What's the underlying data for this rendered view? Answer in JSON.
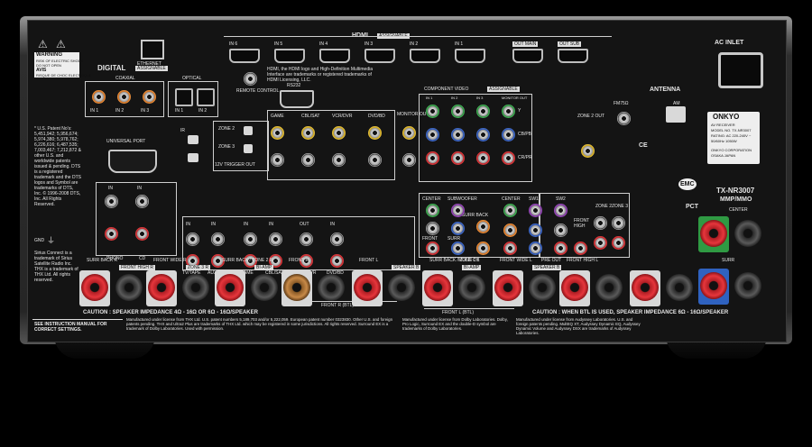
{
  "brand": "ONKYO",
  "model_block": {
    "line1": "AV RECEIVER",
    "line2": "MODEL NO. TX-NR3007",
    "line3": "RATING: AC 220-240V ~",
    "line4": "50/60Hz 1050W",
    "maker1": "ONKYO CORPORATION",
    "maker2": "OSAKA JAPAN"
  },
  "model_name": "TX-NR3007",
  "model_sub": "MMP/MMO",
  "ac_inlet": "AC INLET",
  "antenna": {
    "title": "ANTENNA",
    "fm": "FM75Ω",
    "am": "AM"
  },
  "ethernet": "ETHERNET",
  "hdmi": {
    "title": "HDMI",
    "assignable": "ASSIGNABLE",
    "inputs": [
      "IN 6",
      "IN 5",
      "IN 4",
      "IN 3",
      "IN 2",
      "IN 1"
    ],
    "out_main": "OUT MAIN",
    "out_sub": "OUT SUB"
  },
  "hdmi_notice": "HDMI, the HDMI logo and High-Definition Multimedia Interface are trademarks or registered trademarks of HDMI Licensing, LLC.",
  "remote_control": "REMOTE CONTROL",
  "rs232": "RS232",
  "digital": {
    "title": "DIGITAL",
    "assignable": "ASSIGNABLE",
    "coaxial": "COAXIAL",
    "optical": "OPTICAL",
    "coax_ins": [
      "IN 1",
      "IN 2",
      "IN 3"
    ],
    "opt_ins": [
      "IN 1",
      "IN 2"
    ]
  },
  "universal_port": "UNIVERSAL PORT",
  "ir": "IR",
  "zone2_12v": "12V TRIGGER OUT",
  "zone_labels": {
    "zone2": "ZONE 2",
    "zone3": "ZONE 3"
  },
  "component": {
    "title": "COMPONENT VIDEO",
    "assignable": "ASSIGNABLE",
    "cols": [
      "IN 1",
      "IN 2",
      "IN 3",
      "MONITOR OUT"
    ],
    "rows": [
      "Y",
      "CB/PB",
      "CR/PR"
    ]
  },
  "video_cols": [
    "GAME",
    "CBL/SAT",
    "VCR/DVR",
    "DVD/BD"
  ],
  "monitor_out": "MONITOR OUT",
  "zone2_out": "ZONE 2 OUT",
  "sub_labels": {
    "center": "CENTER",
    "subwoofer": "SUBWOOFER",
    "surr_back": "SURR BACK",
    "front": "FRONT",
    "surr": "SURR",
    "sw1": "SW1",
    "sw2": "SW2",
    "front_high": "FRONT HIGH",
    "front_wide": "FRONT WIDE",
    "pre_out": "PRE OUT",
    "zone2": "ZONE 2",
    "zone3": "ZONE 3"
  },
  "multi_ch": "MULTI CH",
  "bottom_inputs": [
    "PHONO",
    "CD",
    "TV/TAPE",
    "AUX 2",
    "GAME",
    "CBL/SAT",
    "VCR/DVR",
    "DVD/BD"
  ],
  "bottom_in_out": [
    "OUT",
    "IN",
    "IN",
    "IN",
    "IN",
    "IN",
    "OUT",
    "IN"
  ],
  "speaker_groups": [
    {
      "label": "SURR BACK R",
      "sub": "FRONT HIGH R"
    },
    {
      "label": "FRONT WIDE R",
      "sub": "ZONE 3 R"
    },
    {
      "label": "SURR BACK / ZONE 2 R",
      "sub": "BI-AMP"
    },
    {
      "label": "FRONT R",
      "sub": ""
    },
    {
      "label": "FRONT L",
      "sub": "SPEAKER B"
    },
    {
      "label": "SURR BACK / ZONE 2 L",
      "sub": "BI-AMP"
    },
    {
      "label": "FRONT WIDE L",
      "sub": "SPEAKER B"
    },
    {
      "label": "FRONT HIGH L",
      "sub": ""
    }
  ],
  "front_r_bar": "FRONT R (BTL)",
  "front_l_bar": "FRONT L (BTL)",
  "center_spk": "CENTER",
  "surr_spk": "SURR",
  "caution_left": "CAUTION : SPEAKER IMPEDANCE   4Ω - 16Ω OR 6Ω - 16Ω/SPEAKER",
  "caution_right": "CAUTION : WHEN BTL IS USED, SPEAKER IMPEDANCE 6Ω - 16Ω/SPEAKER",
  "see_manual": "SEE INSTRUCTION MANUAL FOR CORRECT SETTINGS.",
  "license_left": "Manufactured under license from THX Ltd. U.S. patent numbers 5,189,703 and/or 5,222,059. European patent number 0323830. Other U.S. and foreign patents pending. THX and Ultra2 Plus are trademarks of THX Ltd. which may be registered in some jurisdictions. All rights reserved. Surround EX is a trademark of Dolby Laboratories. Used with permission.",
  "license_mid": "Manufactured under license from Dolby Laboratories. Dolby, Pro Logic, Surround EX and the double-D symbol are trademarks of Dolby Laboratories.",
  "license_right": "Manufactured under license from Audyssey Laboratories. U.S. and foreign patents pending. MultEQ XT, Audyssey Dynamic EQ, Audyssey Dynamic Volume and Audyssey DSX are trademarks of Audyssey Laboratories.",
  "patents_text": "* U.S. Patent No's: 5,451,942; 5,956,674; 5,974,380; 5,978,762; 6,226,616; 6,487,535; 7,003,467; 7,212,872 & other U.S. and worldwide patents issued & pending. DTS is a registered trademark and the DTS logos and Symbol are trademarks of DTS, Inc. © 1996-2008 DTS, Inc. All Rights Reserved.",
  "xm_text": "Sirius Connect is a trademark of Sirius Satellite Radio Inc. THX is a trademark of THX Ltd. All rights reserved.",
  "warning": {
    "title": "WARNING",
    "l1": "RISK OF ELECTRIC SHOCK",
    "l2": "DO NOT OPEN",
    "avis": "AVIS",
    "l3": "RISQUE DE CHOC ELECTRIQUE",
    "l4": "NE PAS OUVRIR"
  },
  "gnd": "GND",
  "marks": {
    "emc": "EMC",
    "ce": "CE",
    "pct": "PCT"
  }
}
